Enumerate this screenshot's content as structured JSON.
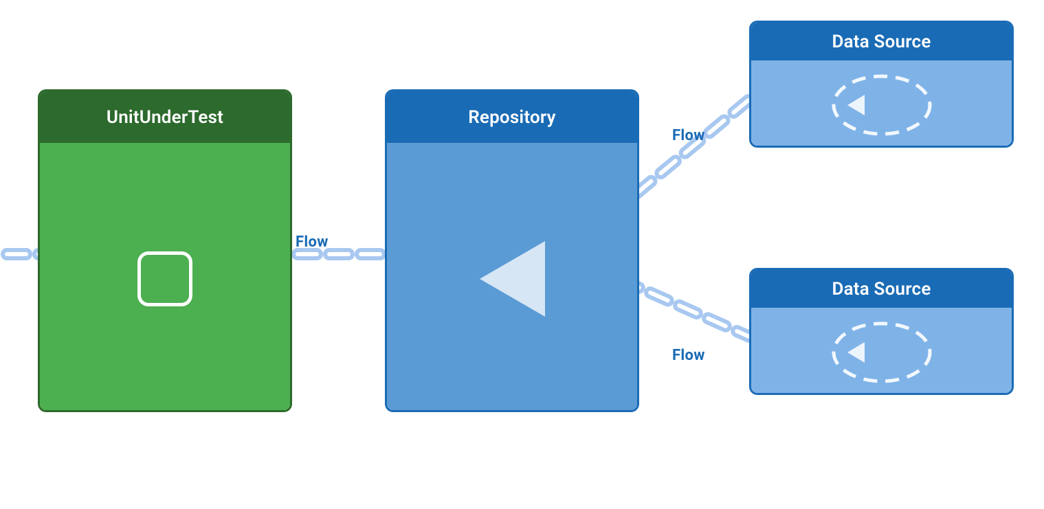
{
  "unit_under_test": {
    "title": "UnitUnderTest"
  },
  "repository": {
    "title": "Repository"
  },
  "data_source_top": {
    "title": "Data Source"
  },
  "data_source_bottom": {
    "title": "Data Source"
  },
  "flow_labels": {
    "unit_flow": "Flow",
    "top_flow": "Flow",
    "bottom_flow": "Flow"
  },
  "colors": {
    "green_dark": "#2d6a2d",
    "green_main": "#4caf50",
    "blue_dark": "#1a6bb5",
    "blue_mid": "#5b9bd5",
    "blue_light": "#7fb3e8",
    "white": "#ffffff",
    "flow_text": "#1a7ce0"
  }
}
